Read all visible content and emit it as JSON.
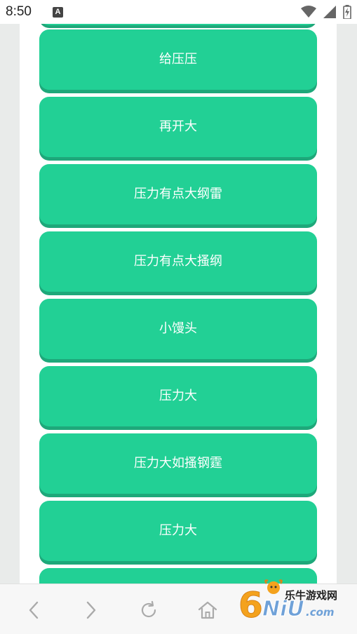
{
  "status_bar": {
    "time": "8:50",
    "notification_icon_letter": "A",
    "icons": [
      "wifi-icon",
      "signal-icon",
      "battery-charging-icon"
    ]
  },
  "buttons": [
    {
      "label": "给压压"
    },
    {
      "label": "再开大"
    },
    {
      "label": "压力有点大纲雷"
    },
    {
      "label": "压力有点大搔纲"
    },
    {
      "label": "小馒头"
    },
    {
      "label": "压力大"
    },
    {
      "label": "压力大如搔钢霆"
    },
    {
      "label": "压力大"
    },
    {
      "label": ""
    }
  ],
  "toolbar": {
    "items": [
      "back-icon",
      "forward-icon",
      "refresh-icon",
      "home-icon"
    ]
  },
  "watermark": {
    "text": "乐牛游戏网",
    "logo_text": "6NiU.com"
  },
  "colors": {
    "button_bg": "#22d095",
    "button_shadow": "#1ea87a",
    "button_text": "#ffffff",
    "page_margin": "#e9ebea"
  }
}
